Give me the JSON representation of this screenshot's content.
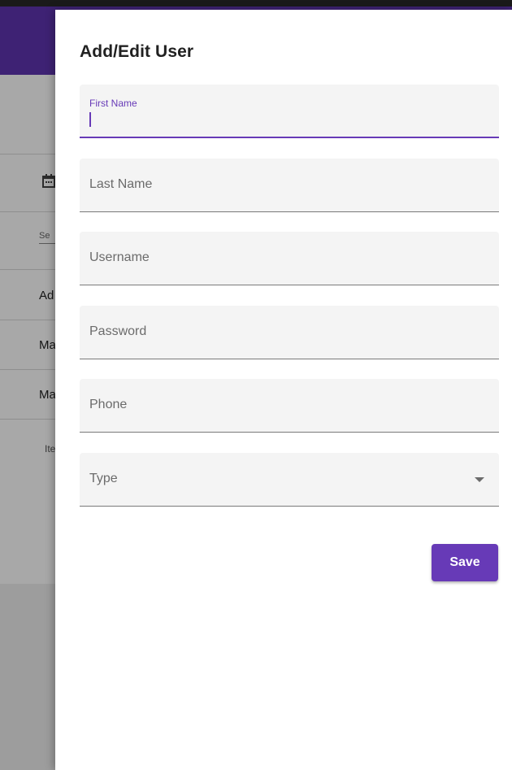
{
  "background": {
    "rows": [
      "Ad",
      "Ma",
      "Ma"
    ],
    "search_fragment": "Se",
    "items_fragment": "Ite"
  },
  "drawer": {
    "title": "Add/Edit User",
    "fields": {
      "first_name": {
        "label": "First Name",
        "value": ""
      },
      "last_name": {
        "label": "Last Name",
        "value": ""
      },
      "username": {
        "label": "Username",
        "value": ""
      },
      "password": {
        "label": "Password",
        "value": ""
      },
      "phone": {
        "label": "Phone",
        "value": ""
      },
      "type": {
        "label": "Type",
        "value": ""
      }
    },
    "save_label": "Save"
  },
  "colors": {
    "accent": "#673ab7",
    "app_bar": "#5e35b1"
  }
}
